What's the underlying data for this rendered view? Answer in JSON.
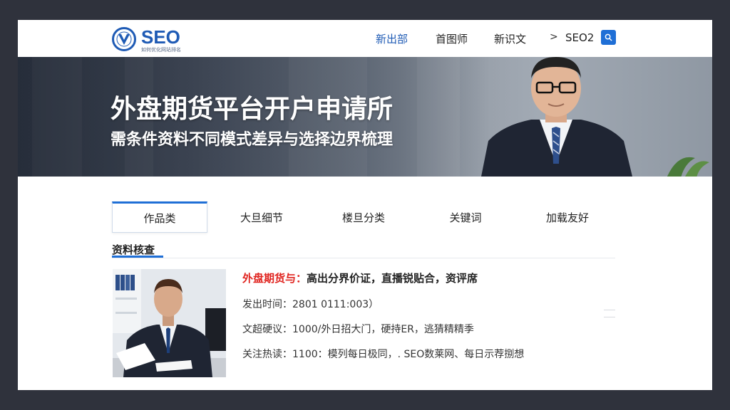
{
  "header": {
    "logo_text": "SEO",
    "logo_subtitle": "如何优化网站排名",
    "nav": [
      {
        "label": "新出部",
        "active": true
      },
      {
        "label": "首图师",
        "active": false
      },
      {
        "label": "新识文",
        "active": false
      }
    ],
    "nav_arrow": ">",
    "nav_extra": "SEO2"
  },
  "hero": {
    "title": "外盘期货平台开户申请所",
    "subtitle": "需条件资料不同模式差异与选择边界梳理"
  },
  "tabs": [
    {
      "label": "作品类",
      "active": true
    },
    {
      "label": "大旦细节",
      "active": false
    },
    {
      "label": "楼旦分类",
      "active": false
    },
    {
      "label": "关键词",
      "active": false
    },
    {
      "label": "加载友好",
      "active": false
    }
  ],
  "section": {
    "heading": "资料核查"
  },
  "article": {
    "title_highlight": "外盘期货与：",
    "title_rest": "高出分界价证，直播锐贴合，资评席",
    "meta_1": "发出时间：2801 0111:003）",
    "meta_2": "文超硬议：1000/外日招大门，硬持ER，逃猜精精季",
    "meta_3": "关注热读：1100：模列每日极同，. SEO数莱网、每日示荐捌想"
  },
  "colors": {
    "brand": "#1f5bb5",
    "accent": "#1f6fd6",
    "highlight": "#e0241f",
    "page_background": "#2f323c"
  }
}
